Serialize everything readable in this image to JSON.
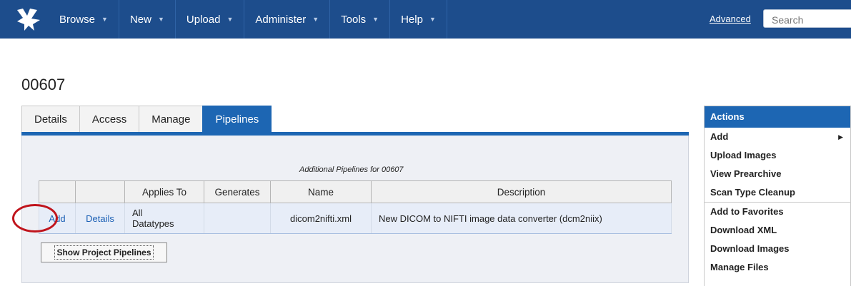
{
  "nav": {
    "logo_icon": "xnat-logo-icon",
    "items": [
      {
        "label": "Browse"
      },
      {
        "label": "New"
      },
      {
        "label": "Upload"
      },
      {
        "label": "Administer"
      },
      {
        "label": "Tools"
      },
      {
        "label": "Help"
      }
    ],
    "advanced_label": "Advanced",
    "search_placeholder": "Search",
    "bar_color": "#1d4d8c"
  },
  "page": {
    "title": "00607"
  },
  "tabs": [
    {
      "label": "Details",
      "active": false
    },
    {
      "label": "Access",
      "active": false
    },
    {
      "label": "Manage",
      "active": false
    },
    {
      "label": "Pipelines",
      "active": true
    }
  ],
  "pipelines": {
    "caption": "Additional Pipelines for 00607",
    "headers": [
      "",
      "",
      "Applies To",
      "Generates",
      "Name",
      "Description"
    ],
    "rows": [
      {
        "add": "Add",
        "details": "Details",
        "applies_line1": "All",
        "applies_line2": "Datatypes",
        "generates": "",
        "name": "dicom2nifti.xml",
        "description": "New DICOM to NIFTI image data converter (dcm2niix)"
      }
    ],
    "show_button": "Show Project Pipelines",
    "highlight_color": "#c0141c"
  },
  "actions": {
    "title": "Actions",
    "group1": [
      "Add",
      "Upload Images",
      "View Prearchive",
      "Scan Type Cleanup"
    ],
    "group2": [
      "Add to Favorites",
      "Download XML",
      "Download Images",
      "Manage Files"
    ],
    "submenu_icon": "triangle-right-icon",
    "accent": "#1d66b3"
  }
}
